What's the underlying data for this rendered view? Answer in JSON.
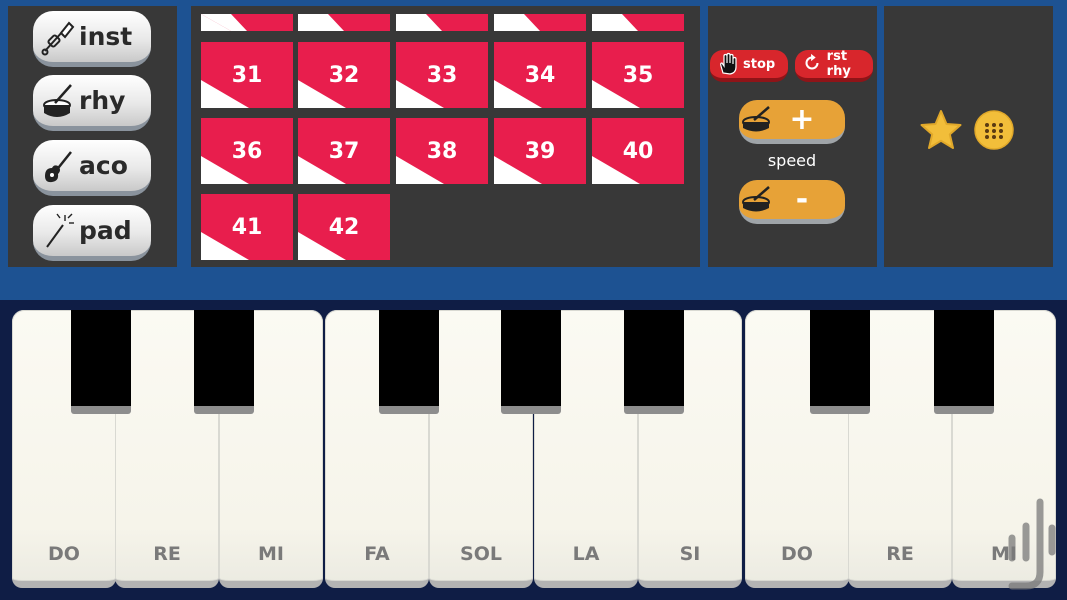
{
  "colors": {
    "header_blue": "#1d5292",
    "panel_dark": "#383838",
    "tile_red": "#e81e4d",
    "button_red": "#d8262c",
    "button_orange": "#e7a237",
    "keyboard_bg": "#0f1d45"
  },
  "instruments": [
    {
      "label": "inst",
      "icon": "trumpet-icon"
    },
    {
      "label": "rhy",
      "icon": "drum-icon"
    },
    {
      "label": "aco",
      "icon": "guitar-icon"
    },
    {
      "label": "pad",
      "icon": "magic-wand-icon"
    }
  ],
  "pattern_tiles": {
    "partial_row": [
      "",
      "",
      "",
      "",
      ""
    ],
    "numbers": [
      "31",
      "32",
      "33",
      "34",
      "35",
      "36",
      "37",
      "38",
      "39",
      "40",
      "41",
      "42"
    ]
  },
  "controls": {
    "stop_label": "stop",
    "reset_label": "rst rhy",
    "speed_label": "speed",
    "plus_sign": "+",
    "minus_sign": "-"
  },
  "favorites": {
    "star_icon": "star-icon",
    "menu_icon": "grid-menu-icon"
  },
  "keys": {
    "white_notes": [
      "DO",
      "RE",
      "MI",
      "FA",
      "SOL",
      "LA",
      "SI",
      "DO",
      "RE",
      "MI"
    ]
  }
}
